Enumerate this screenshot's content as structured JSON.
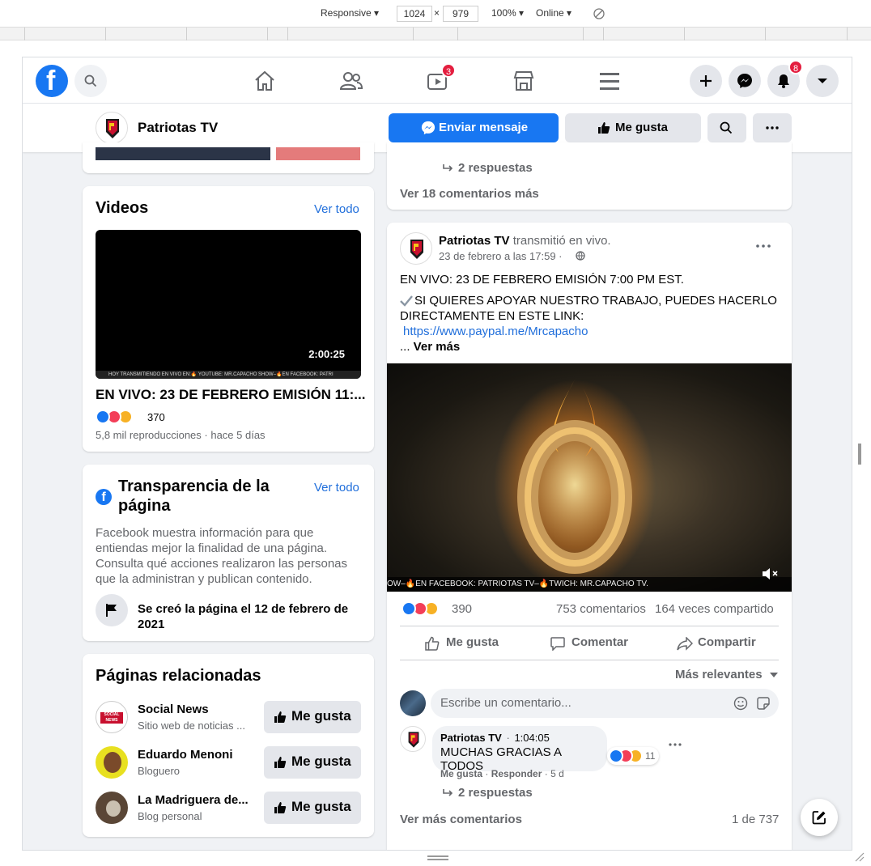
{
  "devtools": {
    "device": "Responsive",
    "width": "1024",
    "times": "×",
    "height": "979",
    "zoom": "100%",
    "network": "Online"
  },
  "header": {
    "watch_badge": "3",
    "notifications_badge": "8"
  },
  "page": {
    "name": "Patriotas TV",
    "send_message_label": "Enviar mensaje",
    "like_label": "Me gusta"
  },
  "videos": {
    "title": "Videos",
    "see_all": "Ver todo",
    "duration": "2:00:25",
    "ticker": "HOY TRANSMITIENDO EN VIVO EN:🔥 YOUTUBE: MR.CAPACHO SHOW–🔥EN FACEBOOK: PATRI",
    "video_title": "EN VIVO: 23 DE FEBRERO EMISIÓN 11:...",
    "reaction_count": "370",
    "meta": "5,8 mil reproducciones · hace 5 días"
  },
  "transparency": {
    "title_line1": "Transparencia de la",
    "title_line2": "página",
    "see_all": "Ver todo",
    "description_lines": [
      "Facebook muestra información para que",
      "entiendas mejor la finalidad de una página.",
      "Consulta qué acciones realizaron las personas",
      "que la administran y publican contenido."
    ],
    "created_line1": "Se creó la página el 12 de febrero de",
    "created_line2": "2021"
  },
  "related": {
    "title": "Páginas relacionadas",
    "like_label": "Me gusta",
    "items": [
      {
        "name": "Social News",
        "category": "Sitio web de noticias ..."
      },
      {
        "name": "Eduardo Menoni",
        "category": "Bloguero"
      },
      {
        "name": "La Madriguera de...",
        "category": "Blog personal"
      }
    ],
    "social_news_logo": "SOCIAL NEWS"
  },
  "prev_post": {
    "replies": "2 respuestas",
    "more_comments": "Ver 18 comentarios más"
  },
  "post": {
    "author": "Patriotas TV",
    "action": "transmitió en vivo.",
    "date": "23 de febrero a las 17:59 ·",
    "line1": "EN VIVO: 23 DE FEBRERO EMISIÓN 7:00 PM EST.",
    "line2": "SI QUIERES APOYAR NUESTRO TRABAJO, PUEDES HACERLO",
    "line3": "DIRECTAMENTE EN ESTE LINK:",
    "link": "https://www.paypal.me/Mrcapacho",
    "see_more_prefix": "... ",
    "see_more": "Ver más",
    "video_ticker": "OW–🔥EN FACEBOOK: PATRIOTAS TV–🔥TWICH: MR.CAPACHO TV.",
    "reaction_count": "390",
    "comments_count": "753 comentarios",
    "shares_count": "164 veces compartido",
    "like_action": "Me gusta",
    "comment_action": "Comentar",
    "share_action": "Compartir",
    "sort_label": "Más relevantes",
    "comment_placeholder": "Escribe un comentario...",
    "comment": {
      "author": "Patriotas TV",
      "separator": "·",
      "time": "1:04:05",
      "text": "MUCHAS GRACIAS A TODOS",
      "reaction_count": "11",
      "like": "Me gusta",
      "reply": "Responder",
      "ago": "· 5 d",
      "dot": "·"
    },
    "replies": "2 respuestas",
    "more_comments": "Ver más comentarios",
    "pagination": "1 de 737"
  },
  "colors": {
    "facebook_blue": "#1877f2",
    "background": "#f0f2f5",
    "notification_red": "#e41e3f"
  }
}
